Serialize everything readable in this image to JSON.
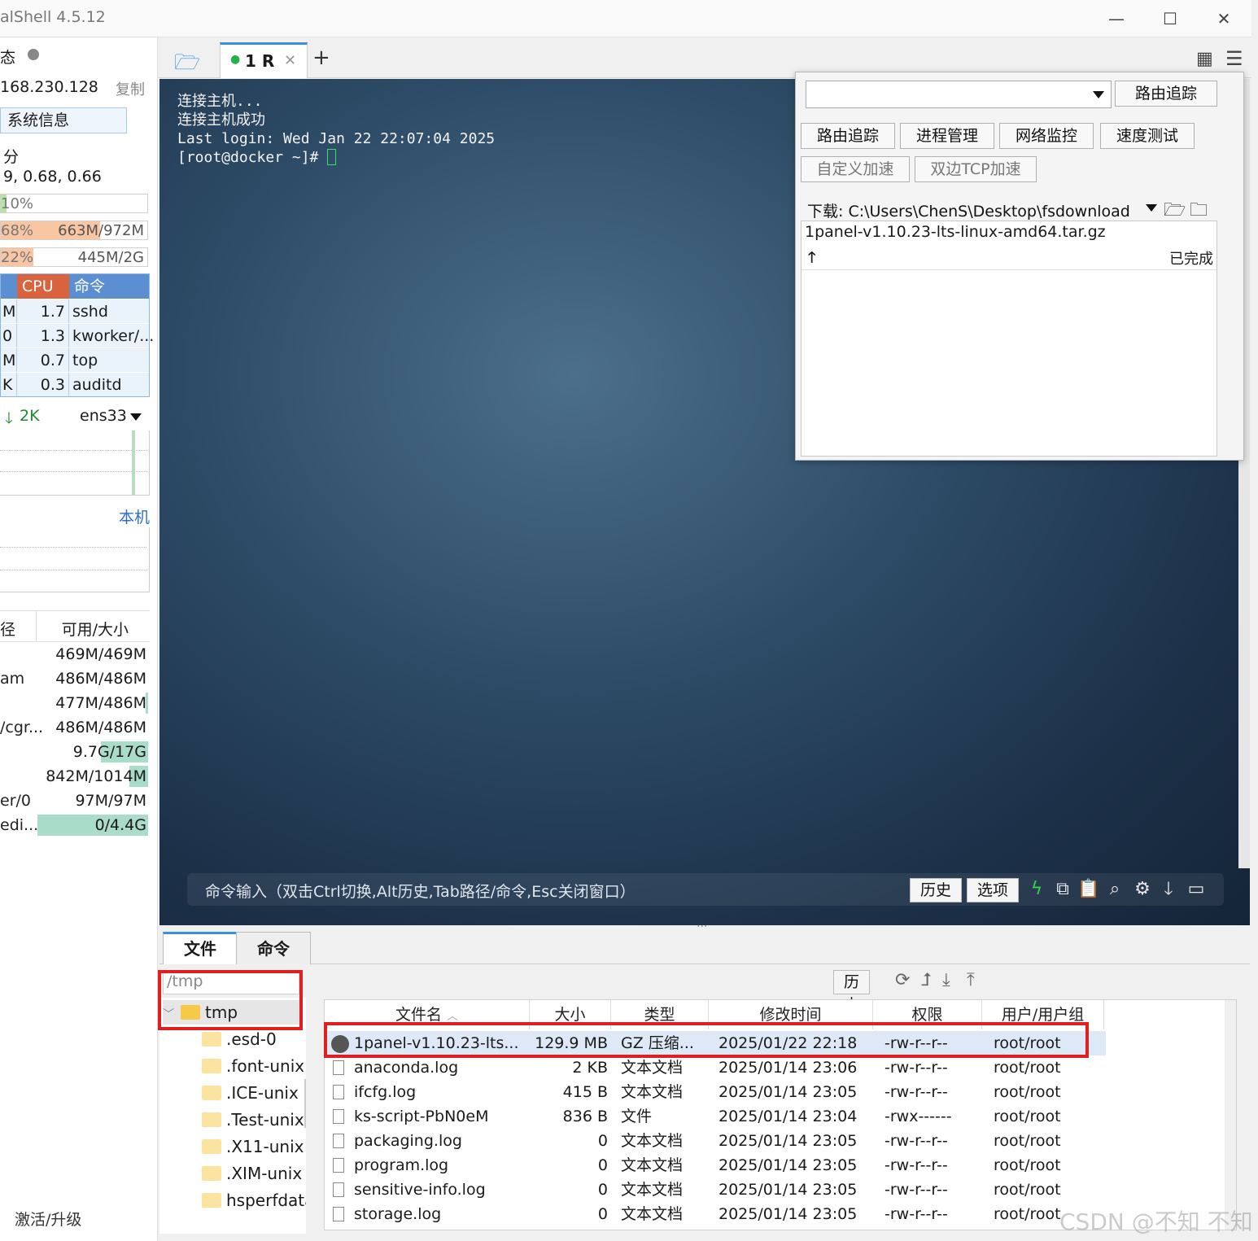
{
  "window": {
    "title": "alShell 4.5.12",
    "controls": {
      "minimize": "—",
      "maximize": "☐",
      "close": "✕"
    }
  },
  "sidebar": {
    "status_label": "态",
    "ip": "168.230.128",
    "copy": "复制",
    "sysinfo_button": "系统信息",
    "uptime_label": "分",
    "load": "9, 0.68, 0.66",
    "cpu": {
      "pct": "10%",
      "level": 0.04
    },
    "mem": {
      "pct": "68%",
      "value": "663M/972M",
      "level": 0.68
    },
    "swap": {
      "pct": "22%",
      "value": "445M/2G",
      "level": 0.22
    },
    "process_headers": [
      "CPU",
      "命令"
    ],
    "processes": [
      {
        "mem": "M",
        "cpu": "1.7",
        "cmd": "sshd"
      },
      {
        "mem": "0",
        "cpu": "1.3",
        "cmd": "kworker/..."
      },
      {
        "mem": "M",
        "cpu": "0.7",
        "cmd": "top"
      },
      {
        "mem": "K",
        "cpu": "0.3",
        "cmd": "auditd"
      }
    ],
    "net": {
      "down": "2K",
      "iface": "ens33"
    },
    "local_label": "本机",
    "disk_headers": [
      "径",
      "可用/大小"
    ],
    "disks": [
      {
        "name": "",
        "value": "469M/469M",
        "used": 0.0
      },
      {
        "name": "am",
        "value": "486M/486M",
        "used": 0.0
      },
      {
        "name": "",
        "value": "477M/486M",
        "used": 0.02
      },
      {
        "name": "/cgr...",
        "value": "486M/486M",
        "used": 0.0
      },
      {
        "name": "",
        "value": "9.7G/17G",
        "used": 0.43
      },
      {
        "name": "",
        "value": "842M/1014M",
        "used": 0.17
      },
      {
        "name": "er/0",
        "value": "97M/97M",
        "used": 0.0
      },
      {
        "name": "edi...",
        "value": "0/4.4G",
        "used": 1.0
      }
    ],
    "upgrade": "激活/升级"
  },
  "tabs": [
    {
      "label": "1 R",
      "active": true
    }
  ],
  "terminal": {
    "lines": [
      "连接主机...",
      "连接主机成功",
      "Last login: Wed Jan 22 22:07:04 2025",
      "[root@docker ~]# "
    ],
    "command_placeholder": "命令输入（双击Ctrl切换,Alt历史,Tab路径/命令,Esc关闭窗口）",
    "history_btn": "历史",
    "options_btn": "选项"
  },
  "tools_popup": {
    "route_btn": "路由追踪",
    "tool_buttons": [
      "路由追踪",
      "进程管理",
      "网络监控",
      "速度测试"
    ],
    "accel_buttons": [
      "自定义加速",
      "双边TCP加速"
    ],
    "download_path": "下载: C:\\Users\\ChenS\\Desktop\\fsdownload",
    "download_item": "1panel-v1.10.23-lts-linux-amd64.tar.gz",
    "download_status": "已完成"
  },
  "bottom": {
    "tabs": [
      "文件",
      "命令"
    ],
    "path": "/tmp",
    "history_btn": "历史",
    "tree_root": "tmp",
    "tree": [
      ".esd-0",
      ".font-unix",
      ".ICE-unix",
      ".Test-unix",
      ".X11-unix",
      ".XIM-unix",
      "hsperfdata"
    ],
    "file_headers": [
      "文件名",
      "大小",
      "类型",
      "修改时间",
      "权限",
      "用户/用户组"
    ],
    "files": [
      {
        "name": "1panel-v1.10.23-lts...",
        "size": "129.9 MB",
        "type": "GZ 压缩...",
        "mtime": "2025/01/22 22:18",
        "perm": "-rw-r--r--",
        "owner": "root/root"
      },
      {
        "name": "anaconda.log",
        "size": "2 KB",
        "type": "文本文档",
        "mtime": "2025/01/14 23:06",
        "perm": "-rw-r--r--",
        "owner": "root/root"
      },
      {
        "name": "ifcfg.log",
        "size": "415 B",
        "type": "文本文档",
        "mtime": "2025/01/14 23:05",
        "perm": "-rw-r--r--",
        "owner": "root/root"
      },
      {
        "name": "ks-script-PbN0eM",
        "size": "836 B",
        "type": "文件",
        "mtime": "2025/01/14 23:04",
        "perm": "-rwx------",
        "owner": "root/root"
      },
      {
        "name": "packaging.log",
        "size": "0",
        "type": "文本文档",
        "mtime": "2025/01/14 23:05",
        "perm": "-rw-r--r--",
        "owner": "root/root"
      },
      {
        "name": "program.log",
        "size": "0",
        "type": "文本文档",
        "mtime": "2025/01/14 23:05",
        "perm": "-rw-r--r--",
        "owner": "root/root"
      },
      {
        "name": "sensitive-info.log",
        "size": "0",
        "type": "文本文档",
        "mtime": "2025/01/14 23:05",
        "perm": "-rw-r--r--",
        "owner": "root/root"
      },
      {
        "name": "storage.log",
        "size": "0",
        "type": "文本文档",
        "mtime": "2025/01/14 23:05",
        "perm": "-rw-r--r--",
        "owner": "root/root"
      }
    ]
  },
  "watermark": "CSDN @不知 不知",
  "colors": {
    "accent": "#3b8fe0",
    "highlight": "#e02020",
    "cpu_header": "#d9633c",
    "terminal_bg": "#2d4b66"
  }
}
